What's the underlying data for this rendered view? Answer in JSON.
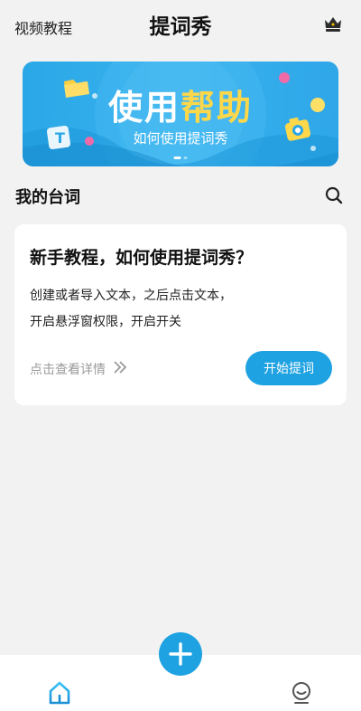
{
  "header": {
    "left_link": "视频教程",
    "title": "提词秀",
    "vip_icon": "crown-icon"
  },
  "banner": {
    "title_white": "使用",
    "title_yellow": "帮助",
    "subtitle": "如何使用提词秀",
    "page_count": 2,
    "active_page": 1
  },
  "section": {
    "title": "我的台词",
    "search_icon": "search-icon"
  },
  "card": {
    "title": "新手教程，如何使用提词秀？",
    "line1": "创建或者导入文本，之后点击文本，",
    "line2": "开启悬浮窗权限，开启开关",
    "detail_link": "点击查看详情",
    "start_button": "开始提词"
  },
  "bottom_nav": {
    "home_icon": "home-icon",
    "add_icon": "plus-icon",
    "me_icon": "user-icon"
  },
  "colors": {
    "accent": "#1fa2e1",
    "banner_yellow": "#ffd84a",
    "background": "#f2f2f2"
  }
}
